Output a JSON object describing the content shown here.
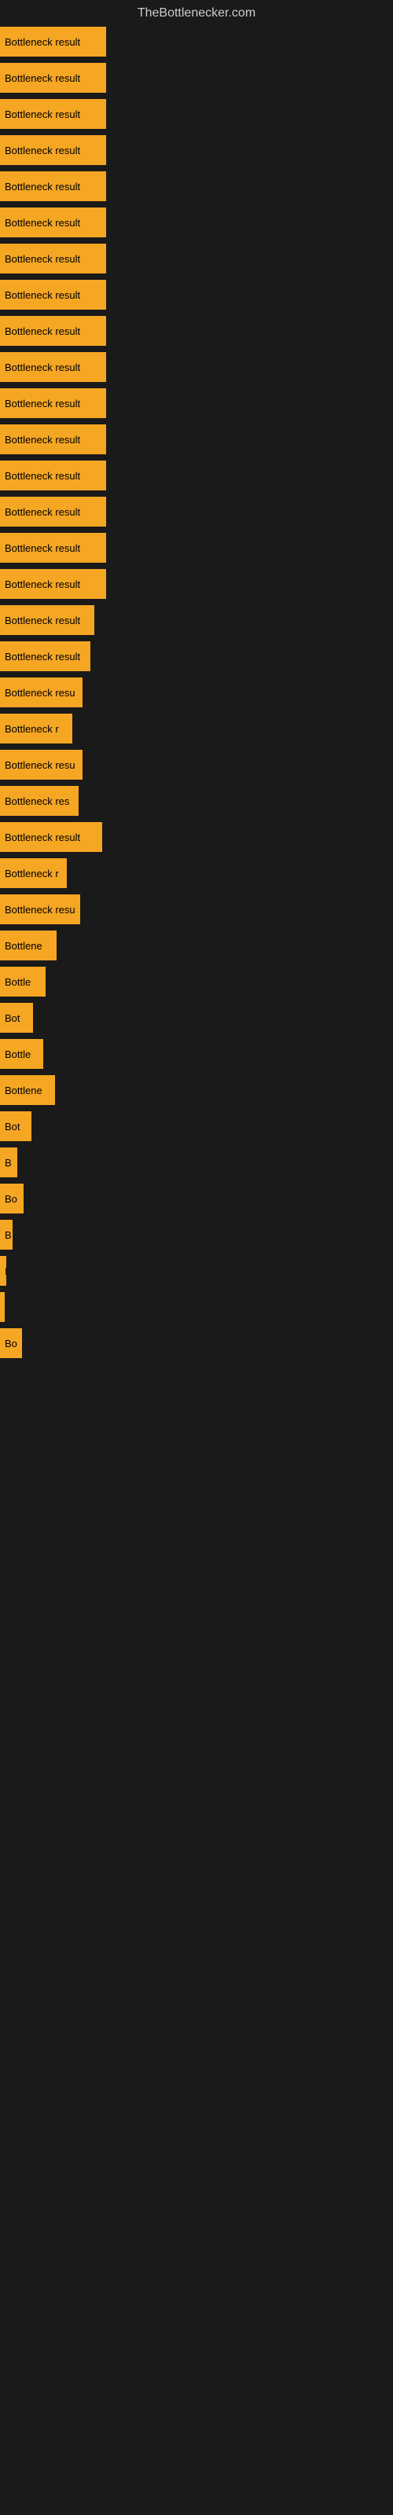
{
  "site": {
    "title": "TheBottlenecker.com"
  },
  "bars": [
    {
      "label": "Bottleneck result",
      "width": 135
    },
    {
      "label": "Bottleneck result",
      "width": 135
    },
    {
      "label": "Bottleneck result",
      "width": 135
    },
    {
      "label": "Bottleneck result",
      "width": 135
    },
    {
      "label": "Bottleneck result",
      "width": 135
    },
    {
      "label": "Bottleneck result",
      "width": 135
    },
    {
      "label": "Bottleneck result",
      "width": 135
    },
    {
      "label": "Bottleneck result",
      "width": 135
    },
    {
      "label": "Bottleneck result",
      "width": 135
    },
    {
      "label": "Bottleneck result",
      "width": 135
    },
    {
      "label": "Bottleneck result",
      "width": 135
    },
    {
      "label": "Bottleneck result",
      "width": 135
    },
    {
      "label": "Bottleneck result",
      "width": 135
    },
    {
      "label": "Bottleneck result",
      "width": 135
    },
    {
      "label": "Bottleneck result",
      "width": 135
    },
    {
      "label": "Bottleneck result",
      "width": 135
    },
    {
      "label": "Bottleneck result",
      "width": 120
    },
    {
      "label": "Bottleneck result",
      "width": 115
    },
    {
      "label": "Bottleneck resu",
      "width": 105
    },
    {
      "label": "Bottleneck r",
      "width": 92
    },
    {
      "label": "Bottleneck resu",
      "width": 105
    },
    {
      "label": "Bottleneck res",
      "width": 100
    },
    {
      "label": "Bottleneck result",
      "width": 130
    },
    {
      "label": "Bottleneck r",
      "width": 85
    },
    {
      "label": "Bottleneck resu",
      "width": 102
    },
    {
      "label": "Bottlene",
      "width": 72
    },
    {
      "label": "Bottle",
      "width": 58
    },
    {
      "label": "Bot",
      "width": 42
    },
    {
      "label": "Bottle",
      "width": 55
    },
    {
      "label": "Bottlene",
      "width": 70
    },
    {
      "label": "Bot",
      "width": 40
    },
    {
      "label": "B",
      "width": 22
    },
    {
      "label": "Bo",
      "width": 30
    },
    {
      "label": "B",
      "width": 16
    },
    {
      "label": "I",
      "width": 8
    },
    {
      "label": "",
      "width": 4
    },
    {
      "label": "Bo",
      "width": 28
    }
  ],
  "colors": {
    "bar": "#f5a623",
    "background": "#1a1a1a",
    "title": "#cccccc"
  }
}
